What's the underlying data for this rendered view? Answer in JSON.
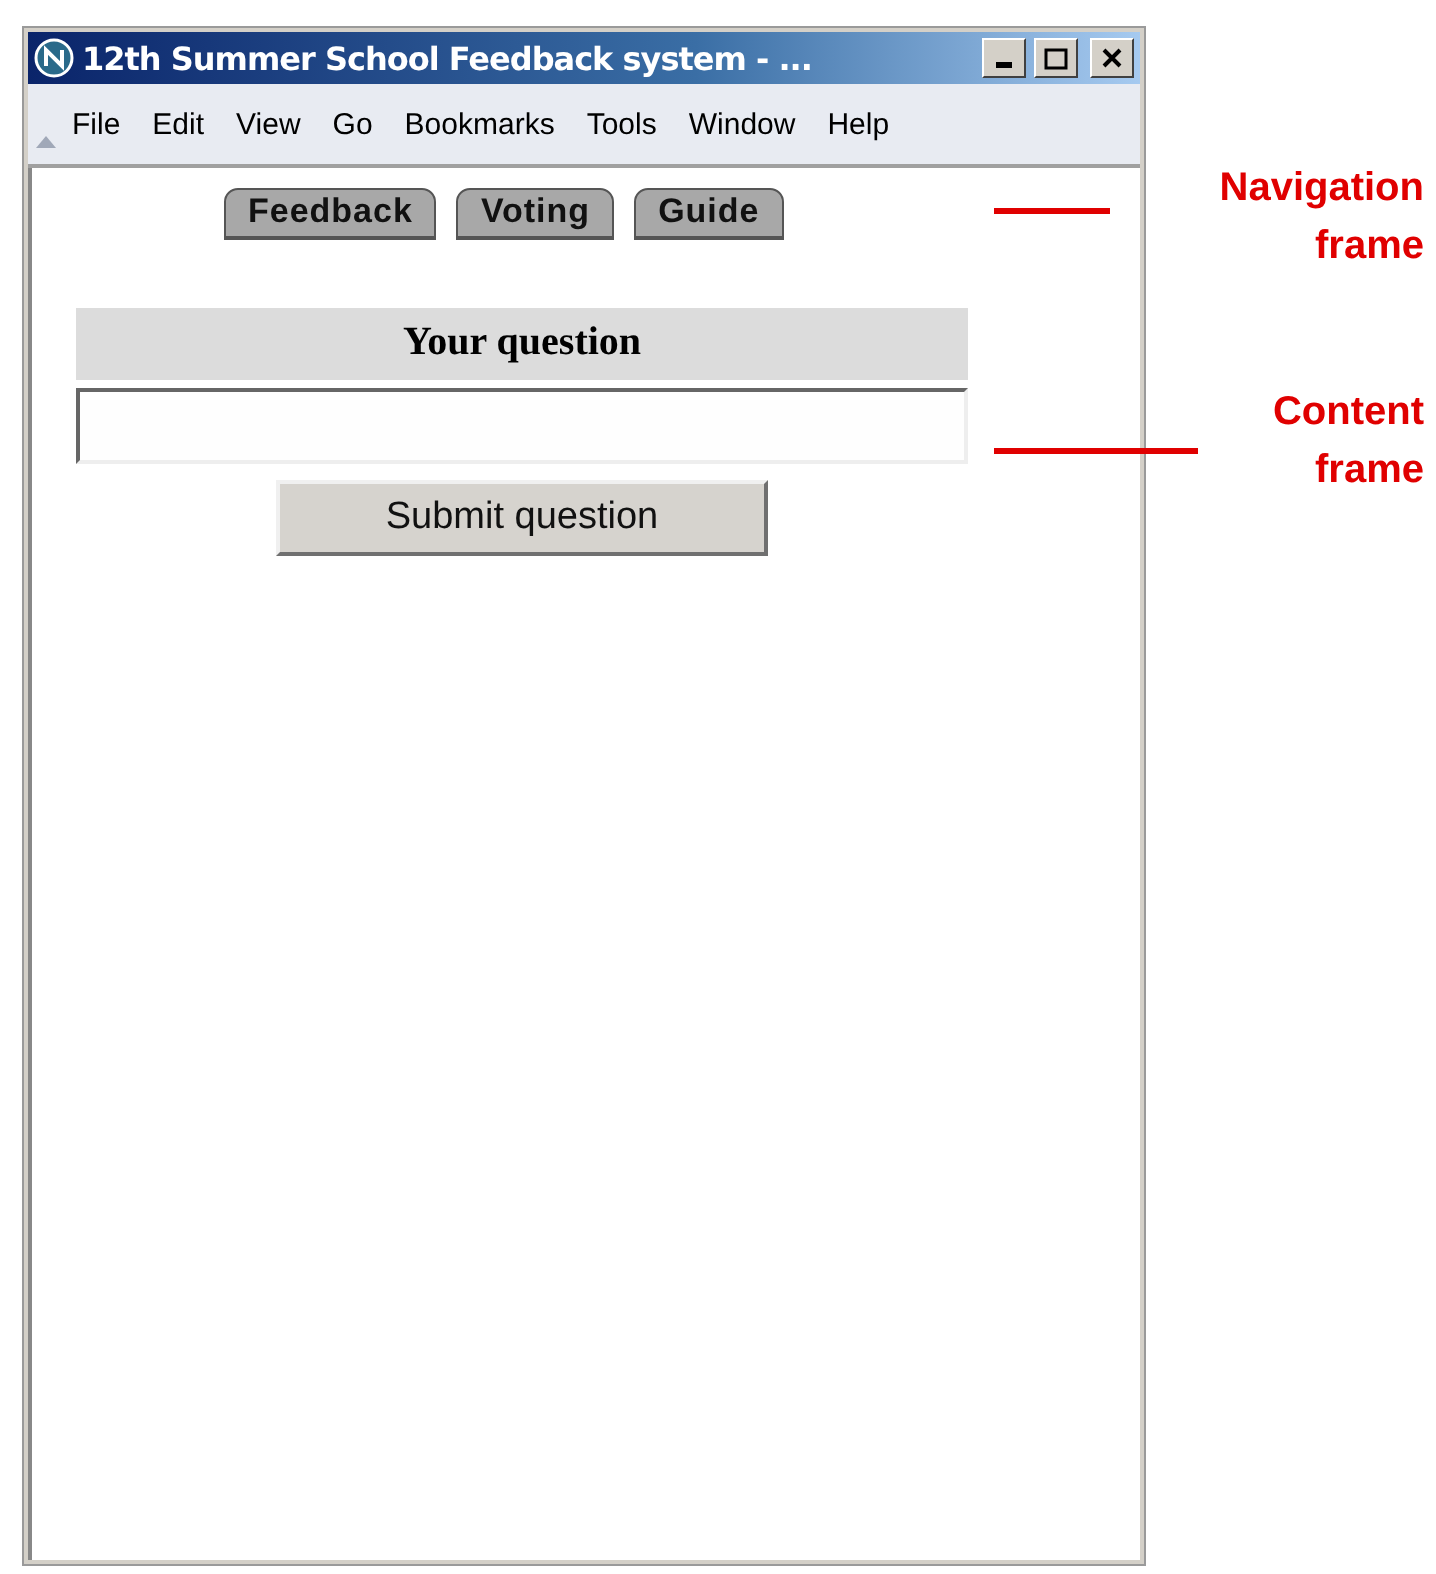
{
  "window": {
    "title": "12th Summer School Feedback system - ..."
  },
  "menu": [
    "File",
    "Edit",
    "View",
    "Go",
    "Bookmarks",
    "Tools",
    "Window",
    "Help"
  ],
  "navigation_tabs": [
    "Feedback",
    "Voting",
    "Guide"
  ],
  "form": {
    "heading": "Your question",
    "button": "Submit question"
  },
  "annotations": [
    {
      "lines": [
        "Navigation",
        "frame"
      ]
    },
    {
      "lines": [
        "Content",
        "frame"
      ]
    }
  ]
}
